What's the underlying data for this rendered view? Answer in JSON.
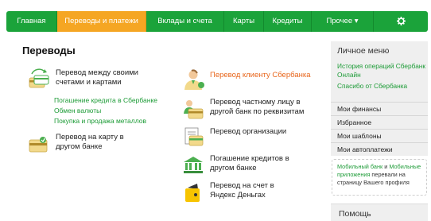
{
  "nav": {
    "items": [
      {
        "label": "Главная"
      },
      {
        "label": "Переводы и платежи"
      },
      {
        "label": "Вклады и счета"
      },
      {
        "label": "Карты"
      },
      {
        "label": "Кредиты"
      },
      {
        "label": "Прочее ▾"
      }
    ],
    "active_color": "#f5a623",
    "bar_color": "#1ba33a",
    "gear_icon": "gear-icon"
  },
  "main": {
    "title": "Переводы",
    "left_items": [
      {
        "label": "Перевод между своими счетами и картами",
        "icon": "cards-exchange-icon"
      },
      {
        "label": "Перевод на карту в другом банке",
        "icon": "card-icon"
      }
    ],
    "sublinks": [
      {
        "label": "Погашение кредита в Сбербанке"
      },
      {
        "label": "Обмен валюты"
      },
      {
        "label": "Покупка и продажа металлов"
      }
    ],
    "right_items": [
      {
        "label": "Перевод клиенту Сбербанка",
        "icon": "client-icon"
      },
      {
        "label": "Перевод частному лицу в другой банк по реквизитам",
        "icon": "person-card-icon"
      },
      {
        "label": "Перевод организации",
        "icon": "organization-icon"
      },
      {
        "label": "Погашение кредитов в другом банке",
        "icon": "bank-icon"
      },
      {
        "label": "Перевод на счет в Яндекс Деньгах",
        "icon": "yandex-wallet-icon"
      }
    ]
  },
  "sidebar": {
    "title": "Личное меню",
    "links": [
      {
        "label": "История операций Сбербанк Онлайн"
      },
      {
        "label": "Спасибо от Сбербанка"
      }
    ],
    "menu": [
      {
        "label": "Мои финансы"
      },
      {
        "label": "Избранное"
      },
      {
        "label": "Мои шаблоны"
      },
      {
        "label": "Мои автоплатежи"
      }
    ],
    "promo": {
      "part1": "Мобильный банк",
      "part2": " и ",
      "part3": "Мобильные приложения",
      "part4": " перевали на страницу Вашего профиля"
    },
    "help": "Помощь"
  }
}
